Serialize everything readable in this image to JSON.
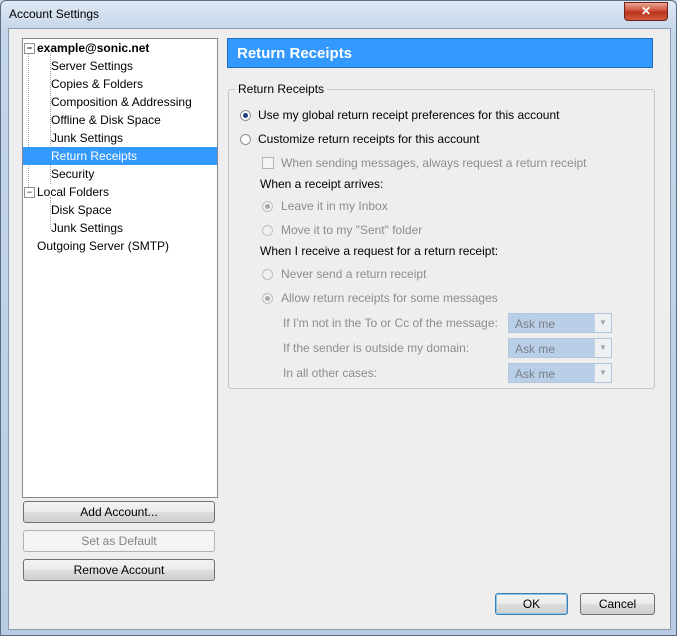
{
  "window": {
    "title": "Account Settings",
    "close_glyph": "✕"
  },
  "tree": {
    "items": [
      {
        "label": "example@sonic.net",
        "level": 0,
        "expander": "−"
      },
      {
        "label": "Server Settings",
        "level": 1
      },
      {
        "label": "Copies & Folders",
        "level": 1
      },
      {
        "label": "Composition & Addressing",
        "level": 1
      },
      {
        "label": "Offline & Disk Space",
        "level": 1
      },
      {
        "label": "Junk Settings",
        "level": 1
      },
      {
        "label": "Return Receipts",
        "level": 1,
        "selected": true
      },
      {
        "label": "Security",
        "level": 1
      },
      {
        "label": "Local Folders",
        "level": 0,
        "expander": "−"
      },
      {
        "label": "Disk Space",
        "level": 1
      },
      {
        "label": "Junk Settings",
        "level": 1
      },
      {
        "label": "Outgoing Server (SMTP)",
        "level": 0
      }
    ]
  },
  "buttons": {
    "add_account": "Add Account...",
    "set_default": "Set as Default",
    "remove_account": "Remove Account",
    "ok": "OK",
    "cancel": "Cancel"
  },
  "panel": {
    "header": "Return Receipts",
    "group_label": "Return Receipts",
    "use_global": "Use my global return receipt preferences for this account",
    "customize": "Customize return receipts for this account",
    "always_request": "When sending messages, always request a return receipt",
    "when_arrives": "When a receipt arrives:",
    "leave_inbox": "Leave it in my Inbox",
    "move_sent": "Move it to my \"Sent\" folder",
    "when_request": "When I receive a request for a return receipt:",
    "never_send": "Never send a return receipt",
    "allow_some": "Allow return receipts for some messages",
    "not_in_to": "If I'm not in the To or Cc of the message:",
    "sender_outside": "If the sender is outside my domain:",
    "other_cases": "In all other cases:",
    "ask_me": "Ask me",
    "dropdown_glyph": "▼"
  }
}
